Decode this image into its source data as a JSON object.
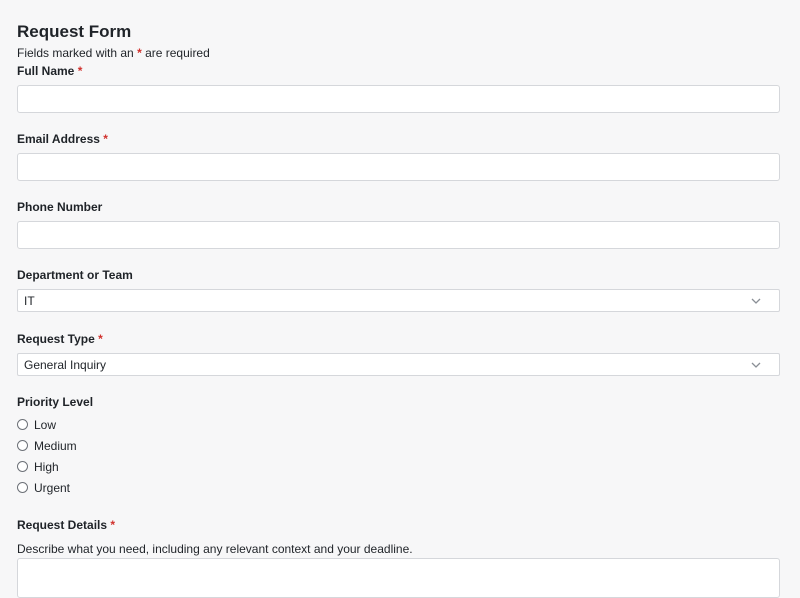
{
  "form": {
    "title": "Request Form",
    "required_note_prefix": "Fields marked with an",
    "required_marker": "*",
    "required_note_suffix": "are required",
    "fields": {
      "full_name": {
        "label": "Full Name",
        "required": true,
        "value": ""
      },
      "email": {
        "label": "Email Address",
        "required": true,
        "value": ""
      },
      "phone": {
        "label": "Phone Number",
        "required": false,
        "value": ""
      },
      "department": {
        "label": "Department or Team",
        "required": false,
        "selected": "IT"
      },
      "request_type": {
        "label": "Request Type",
        "required": true,
        "selected": "General Inquiry"
      },
      "priority": {
        "label": "Priority Level",
        "options": [
          "Low",
          "Medium",
          "High",
          "Urgent"
        ],
        "selected": null
      },
      "details": {
        "label": "Request Details",
        "required": true,
        "helper": "Describe what you need, including any relevant context and your deadline.",
        "value": ""
      }
    }
  }
}
